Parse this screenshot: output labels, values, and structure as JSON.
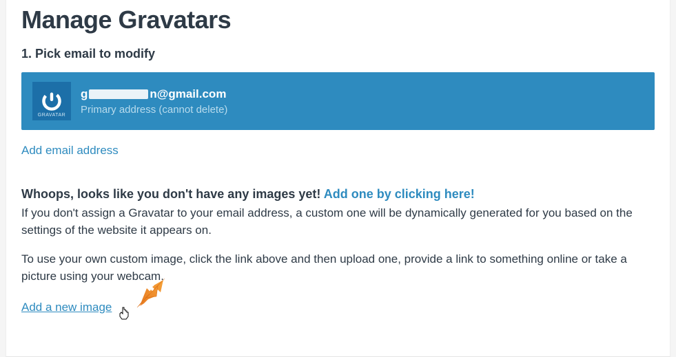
{
  "header": {
    "title": "Manage Gravatars"
  },
  "step1": {
    "heading": "1. Pick email to modify",
    "email_prefix": "g",
    "email_suffix": "n@gmail.com",
    "subtitle": "Primary address (cannot delete)",
    "avatar_label": "GRAVATAR"
  },
  "links": {
    "add_email": "Add email address",
    "add_new_image": "Add a new image"
  },
  "whoops": {
    "bold": "Whoops, looks like you don't have any images yet! ",
    "cta": "Add one by clicking here!"
  },
  "para1": "If you don't assign a Gravatar to your email address, a custom one will be dynamically generated for you based on the settings of the website it appears on.",
  "para2": "To use your own custom image, click the link above and then upload one, provide a link to something online or take a picture using your webcam."
}
